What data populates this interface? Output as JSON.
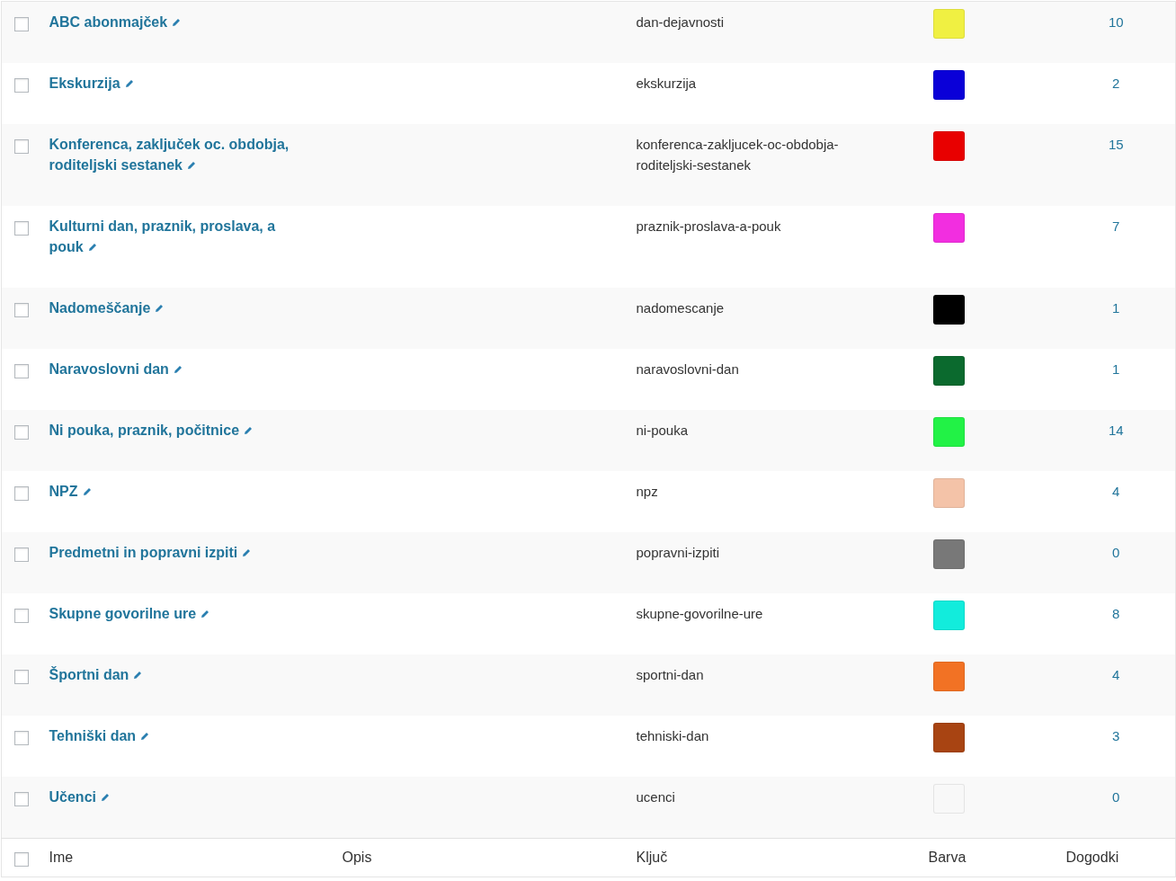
{
  "table": {
    "rows": [
      {
        "checked": false,
        "name": "ABC abonmajček",
        "slug": "dan-dejavnosti",
        "color": "#f0f042",
        "count": "10"
      },
      {
        "checked": false,
        "name": "Ekskurzija",
        "slug": "ekskurzija",
        "color": "#0a00d8",
        "count": "2"
      },
      {
        "checked": false,
        "name": "Konferenca, zaključek oc. obdobja, roditeljski sestanek",
        "slug": "konferenca-zakljucek-oc-obdobja-roditeljski-sestanek",
        "color": "#e80000",
        "count": "15"
      },
      {
        "checked": false,
        "name": "Kulturni dan, praznik, proslava, a pouk",
        "slug": "praznik-proslava-a-pouk",
        "color": "#f22ee0",
        "count": "7"
      },
      {
        "checked": false,
        "name": "Nadomeščanje",
        "slug": "nadomescanje",
        "color": "#000000",
        "count": "1"
      },
      {
        "checked": false,
        "name": "Naravoslovni dan",
        "slug": "naravoslovni-dan",
        "color": "#0b6a2e",
        "count": "1"
      },
      {
        "checked": false,
        "name": "Ni pouka, praznik, počitnice",
        "slug": "ni-pouka",
        "color": "#22f246",
        "count": "14"
      },
      {
        "checked": false,
        "name": "NPZ",
        "slug": "npz",
        "color": "#f4c3a8",
        "count": "4"
      },
      {
        "checked": false,
        "name": "Predmetni in popravni izpiti",
        "slug": "popravni-izpiti",
        "color": "#787878",
        "count": "0"
      },
      {
        "checked": false,
        "name": "Skupne govorilne ure",
        "slug": "skupne-govorilne-ure",
        "color": "#12ecdc",
        "count": "8"
      },
      {
        "checked": false,
        "name": "Športni dan",
        "slug": "sportni-dan",
        "color": "#f27224",
        "count": "4"
      },
      {
        "checked": false,
        "name": "Tehniški dan",
        "slug": "tehniski-dan",
        "color": "#a84412",
        "count": "3"
      },
      {
        "checked": false,
        "name": "Učenci",
        "slug": "ucenci",
        "color": "#f8f8f8",
        "count": "0"
      }
    ],
    "footer": {
      "checked": false,
      "columns": [
        "Ime",
        "Opis",
        "Ključ",
        "Barva",
        "Dogodki"
      ]
    }
  }
}
